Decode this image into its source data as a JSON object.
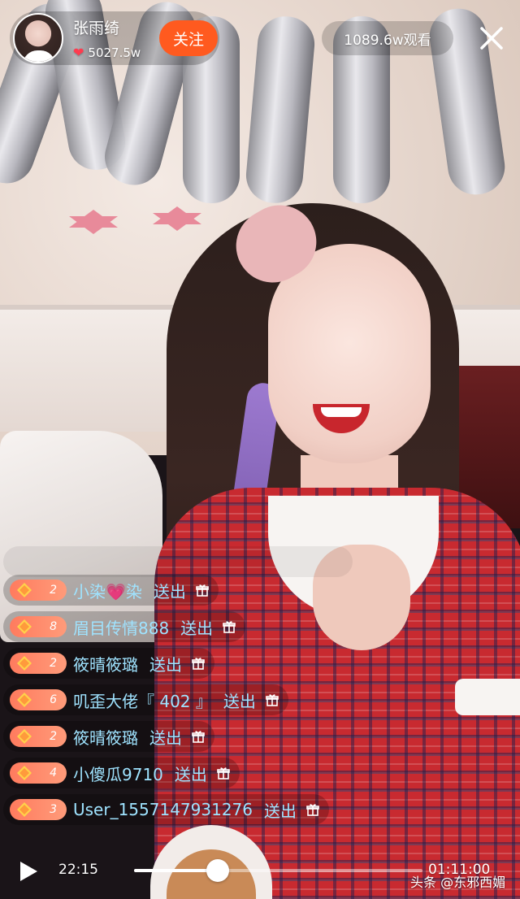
{
  "host": {
    "name": "张雨绮",
    "likes": "5027.5w",
    "follow_label": "关注"
  },
  "viewers": "1089.6w观看",
  "icons": {
    "close": "close-icon",
    "heart": "heart-icon",
    "gift": "gift-icon",
    "play": "play-icon",
    "level_gem": "diamond-icon"
  },
  "colors": {
    "follow_button": "#ff5a1f",
    "username": "#9fe3ff",
    "level_badge": "#ff8a6a",
    "heart": "#ff3b4f"
  },
  "gift_feed": [
    {
      "level": "2",
      "sender": "小染💗染",
      "action": "送出"
    },
    {
      "level": "8",
      "sender": "眉目传情888",
      "action": "送出"
    },
    {
      "level": "2",
      "sender": "筱晴筱璐",
      "action": "送出"
    },
    {
      "level": "6",
      "sender": "叽歪大佬『 402 』",
      "action": "送出"
    },
    {
      "level": "2",
      "sender": "筱晴筱璐",
      "action": "送出"
    },
    {
      "level": "4",
      "sender": "小傻瓜9710",
      "action": "送出"
    },
    {
      "level": "3",
      "sender": "User_1557147931276",
      "action": "送出"
    }
  ],
  "player": {
    "current_time": "22:15",
    "total_time": "01:11:00",
    "progress": 0.29
  },
  "watermark": "头条 @东邪西媚"
}
